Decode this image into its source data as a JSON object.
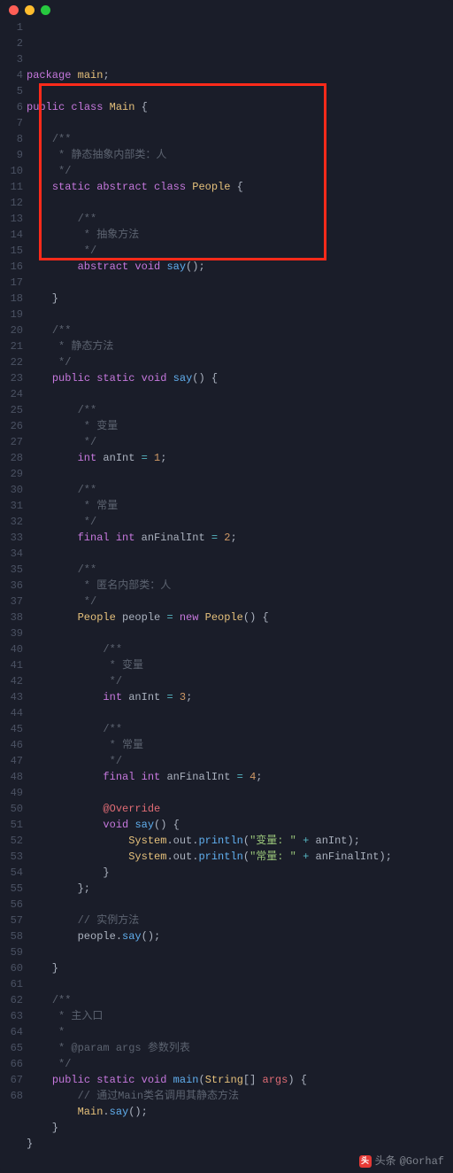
{
  "window": {
    "dots": [
      "red",
      "yellow",
      "green"
    ]
  },
  "lines": [
    [
      [
        "kw",
        "package"
      ],
      [
        "pun",
        " "
      ],
      [
        "cls",
        "main"
      ],
      [
        "pun",
        ";"
      ]
    ],
    [],
    [
      [
        "kw",
        "public"
      ],
      [
        "pun",
        " "
      ],
      [
        "kw",
        "class"
      ],
      [
        "pun",
        " "
      ],
      [
        "cls",
        "Main"
      ],
      [
        "pun",
        " {"
      ]
    ],
    [],
    [
      [
        "pun",
        "    "
      ],
      [
        "cmt",
        "/**"
      ]
    ],
    [
      [
        "pun",
        "    "
      ],
      [
        "cmt",
        " * 静态抽象内部类：人"
      ]
    ],
    [
      [
        "pun",
        "    "
      ],
      [
        "cmt",
        " */"
      ]
    ],
    [
      [
        "pun",
        "    "
      ],
      [
        "kw",
        "static"
      ],
      [
        "pun",
        " "
      ],
      [
        "kw",
        "abstract"
      ],
      [
        "pun",
        " "
      ],
      [
        "kw",
        "class"
      ],
      [
        "pun",
        " "
      ],
      [
        "cls",
        "People"
      ],
      [
        "pun",
        " {"
      ]
    ],
    [],
    [
      [
        "pun",
        "        "
      ],
      [
        "cmt",
        "/**"
      ]
    ],
    [
      [
        "pun",
        "        "
      ],
      [
        "cmt",
        " * 抽象方法"
      ]
    ],
    [
      [
        "pun",
        "        "
      ],
      [
        "cmt",
        " */"
      ]
    ],
    [
      [
        "pun",
        "        "
      ],
      [
        "kw",
        "abstract"
      ],
      [
        "pun",
        " "
      ],
      [
        "kw",
        "void"
      ],
      [
        "pun",
        " "
      ],
      [
        "fn",
        "say"
      ],
      [
        "pun",
        "();"
      ]
    ],
    [],
    [
      [
        "pun",
        "    }"
      ]
    ],
    [],
    [
      [
        "pun",
        "    "
      ],
      [
        "cmt",
        "/**"
      ]
    ],
    [
      [
        "pun",
        "    "
      ],
      [
        "cmt",
        " * 静态方法"
      ]
    ],
    [
      [
        "pun",
        "    "
      ],
      [
        "cmt",
        " */"
      ]
    ],
    [
      [
        "pun",
        "    "
      ],
      [
        "kw",
        "public"
      ],
      [
        "pun",
        " "
      ],
      [
        "kw",
        "static"
      ],
      [
        "pun",
        " "
      ],
      [
        "kw",
        "void"
      ],
      [
        "pun",
        " "
      ],
      [
        "fn",
        "say"
      ],
      [
        "pun",
        "() {"
      ]
    ],
    [],
    [
      [
        "pun",
        "        "
      ],
      [
        "cmt",
        "/**"
      ]
    ],
    [
      [
        "pun",
        "        "
      ],
      [
        "cmt",
        " * 变量"
      ]
    ],
    [
      [
        "pun",
        "        "
      ],
      [
        "cmt",
        " */"
      ]
    ],
    [
      [
        "pun",
        "        "
      ],
      [
        "kw",
        "int"
      ],
      [
        "pun",
        " anInt "
      ],
      [
        "op",
        "="
      ],
      [
        "pun",
        " "
      ],
      [
        "num",
        "1"
      ],
      [
        "pun",
        ";"
      ]
    ],
    [],
    [
      [
        "pun",
        "        "
      ],
      [
        "cmt",
        "/**"
      ]
    ],
    [
      [
        "pun",
        "        "
      ],
      [
        "cmt",
        " * 常量"
      ]
    ],
    [
      [
        "pun",
        "        "
      ],
      [
        "cmt",
        " */"
      ]
    ],
    [
      [
        "pun",
        "        "
      ],
      [
        "kw",
        "final"
      ],
      [
        "pun",
        " "
      ],
      [
        "kw",
        "int"
      ],
      [
        "pun",
        " anFinalInt "
      ],
      [
        "op",
        "="
      ],
      [
        "pun",
        " "
      ],
      [
        "num",
        "2"
      ],
      [
        "pun",
        ";"
      ]
    ],
    [],
    [
      [
        "pun",
        "        "
      ],
      [
        "cmt",
        "/**"
      ]
    ],
    [
      [
        "pun",
        "        "
      ],
      [
        "cmt",
        " * 匿名内部类：人"
      ]
    ],
    [
      [
        "pun",
        "        "
      ],
      [
        "cmt",
        " */"
      ]
    ],
    [
      [
        "pun",
        "        "
      ],
      [
        "cls",
        "People"
      ],
      [
        "pun",
        " people "
      ],
      [
        "op",
        "="
      ],
      [
        "pun",
        " "
      ],
      [
        "kw",
        "new"
      ],
      [
        "pun",
        " "
      ],
      [
        "cls",
        "People"
      ],
      [
        "pun",
        "() {"
      ]
    ],
    [],
    [
      [
        "pun",
        "            "
      ],
      [
        "cmt",
        "/**"
      ]
    ],
    [
      [
        "pun",
        "            "
      ],
      [
        "cmt",
        " * 变量"
      ]
    ],
    [
      [
        "pun",
        "            "
      ],
      [
        "cmt",
        " */"
      ]
    ],
    [
      [
        "pun",
        "            "
      ],
      [
        "kw",
        "int"
      ],
      [
        "pun",
        " anInt "
      ],
      [
        "op",
        "="
      ],
      [
        "pun",
        " "
      ],
      [
        "num",
        "3"
      ],
      [
        "pun",
        ";"
      ]
    ],
    [],
    [
      [
        "pun",
        "            "
      ],
      [
        "cmt",
        "/**"
      ]
    ],
    [
      [
        "pun",
        "            "
      ],
      [
        "cmt",
        " * 常量"
      ]
    ],
    [
      [
        "pun",
        "            "
      ],
      [
        "cmt",
        " */"
      ]
    ],
    [
      [
        "pun",
        "            "
      ],
      [
        "kw",
        "final"
      ],
      [
        "pun",
        " "
      ],
      [
        "kw",
        "int"
      ],
      [
        "pun",
        " anFinalInt "
      ],
      [
        "op",
        "="
      ],
      [
        "pun",
        " "
      ],
      [
        "num",
        "4"
      ],
      [
        "pun",
        ";"
      ]
    ],
    [],
    [
      [
        "pun",
        "            "
      ],
      [
        "ann",
        "@Override"
      ]
    ],
    [
      [
        "pun",
        "            "
      ],
      [
        "kw",
        "void"
      ],
      [
        "pun",
        " "
      ],
      [
        "fn",
        "say"
      ],
      [
        "pun",
        "() {"
      ]
    ],
    [
      [
        "pun",
        "                "
      ],
      [
        "cls",
        "System"
      ],
      [
        "pun",
        ".out."
      ],
      [
        "fn",
        "println"
      ],
      [
        "pun",
        "("
      ],
      [
        "str",
        "\"变量: \""
      ],
      [
        "pun",
        " "
      ],
      [
        "op",
        "+"
      ],
      [
        "pun",
        " anInt);"
      ]
    ],
    [
      [
        "pun",
        "                "
      ],
      [
        "cls",
        "System"
      ],
      [
        "pun",
        ".out."
      ],
      [
        "fn",
        "println"
      ],
      [
        "pun",
        "("
      ],
      [
        "str",
        "\"常量: \""
      ],
      [
        "pun",
        " "
      ],
      [
        "op",
        "+"
      ],
      [
        "pun",
        " anFinalInt);"
      ]
    ],
    [
      [
        "pun",
        "            }"
      ]
    ],
    [
      [
        "pun",
        "        };"
      ]
    ],
    [],
    [
      [
        "pun",
        "        "
      ],
      [
        "cmt",
        "// 实例方法"
      ]
    ],
    [
      [
        "pun",
        "        people."
      ],
      [
        "fn",
        "say"
      ],
      [
        "pun",
        "();"
      ]
    ],
    [],
    [
      [
        "pun",
        "    }"
      ]
    ],
    [],
    [
      [
        "pun",
        "    "
      ],
      [
        "cmt",
        "/**"
      ]
    ],
    [
      [
        "pun",
        "    "
      ],
      [
        "cmt",
        " * 主入口"
      ]
    ],
    [
      [
        "pun",
        "    "
      ],
      [
        "cmt",
        " *"
      ]
    ],
    [
      [
        "pun",
        "    "
      ],
      [
        "cmt",
        " * @param args 参数列表"
      ]
    ],
    [
      [
        "pun",
        "    "
      ],
      [
        "cmt",
        " */"
      ]
    ],
    [
      [
        "pun",
        "    "
      ],
      [
        "kw",
        "public"
      ],
      [
        "pun",
        " "
      ],
      [
        "kw",
        "static"
      ],
      [
        "pun",
        " "
      ],
      [
        "kw",
        "void"
      ],
      [
        "pun",
        " "
      ],
      [
        "fn",
        "main"
      ],
      [
        "pun",
        "("
      ],
      [
        "cls",
        "String"
      ],
      [
        "pun",
        "[] "
      ],
      [
        "id",
        "args"
      ],
      [
        "pun",
        ") {"
      ]
    ],
    [
      [
        "pun",
        "        "
      ],
      [
        "cmt",
        "// 通过Main类名调用其静态方法"
      ]
    ],
    [
      [
        "pun",
        "        "
      ],
      [
        "cls",
        "Main"
      ],
      [
        "pun",
        "."
      ],
      [
        "fn",
        "say"
      ],
      [
        "pun",
        "();"
      ]
    ],
    [
      [
        "pun",
        "    }"
      ]
    ],
    [
      [
        "pun",
        "}"
      ]
    ]
  ],
  "highlight": {
    "startLine": 5,
    "endLine": 15
  },
  "footer": {
    "prefix": "头条",
    "handle": "@Gorhaf"
  }
}
